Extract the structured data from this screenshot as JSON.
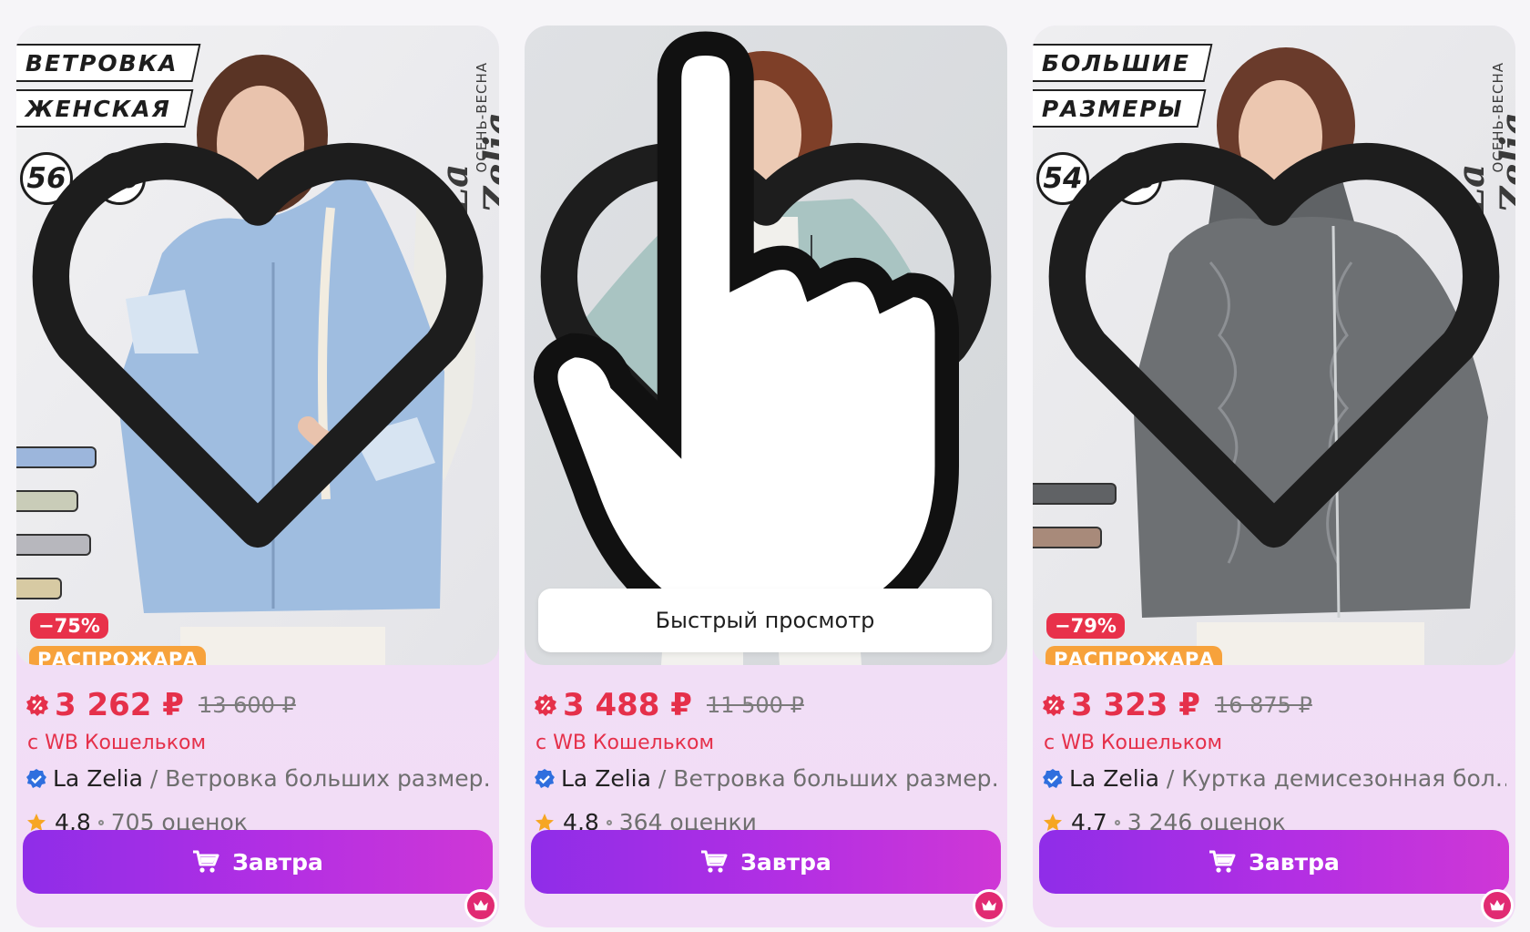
{
  "cards": [
    {
      "tags": [
        "ВЕТРОВКА",
        "ЖЕНСКАЯ"
      ],
      "sizes": [
        "56",
        "66"
      ],
      "brand_logo": "La Zelia",
      "season": "ОСЕНЬ-ВЕСНА",
      "discount": "−75%",
      "sale_badge": "РАСПРОЖАРА",
      "price": "3 262 ₽",
      "old_price": "13 600 ₽",
      "wallet": "с WB Кошельком",
      "brand": "La Zelia",
      "title": "/ Ветровка больших размер…",
      "rating": "4,8",
      "reviews": "705 оценок",
      "cart_label": "Завтра",
      "jacket_color": "#9fbde0",
      "swatches": [
        "#9cb6dc",
        "#c9ccb8",
        "#b7b7bd",
        "#d7caa3"
      ]
    },
    {
      "quick_view": "Быстрый просмотр",
      "price": "3 488 ₽",
      "old_price": "11 500 ₽",
      "wallet": "с WB Кошельком",
      "brand": "La Zelia",
      "title": "/ Ветровка больших размер…",
      "rating": "4,8",
      "reviews": "364 оценки",
      "cart_label": "Завтра",
      "jacket_color": "#a9c4c2"
    },
    {
      "tags": [
        "БОЛЬШИЕ",
        "РАЗМЕРЫ"
      ],
      "sizes": [
        "54",
        "68"
      ],
      "brand_logo": "La Zelia",
      "season": "ОСЕНЬ-ВЕСНА",
      "discount": "−79%",
      "sale_badge": "РАСПРОЖАРА",
      "price": "3 323 ₽",
      "old_price": "16 875 ₽",
      "wallet": "с WB Кошельком",
      "brand": "La Zelia",
      "title": "/ Куртка демисезонная бол…",
      "rating": "4,7",
      "reviews": "3 246 оценок",
      "cart_label": "Завтра",
      "jacket_color": "#6d7073",
      "swatches": [
        "#606265",
        "#a88a7a"
      ]
    }
  ],
  "colors": {
    "price": "#e5304a",
    "button_start": "#8f2de8",
    "button_end": "#cf37d6",
    "sale": "#f7a23b"
  }
}
